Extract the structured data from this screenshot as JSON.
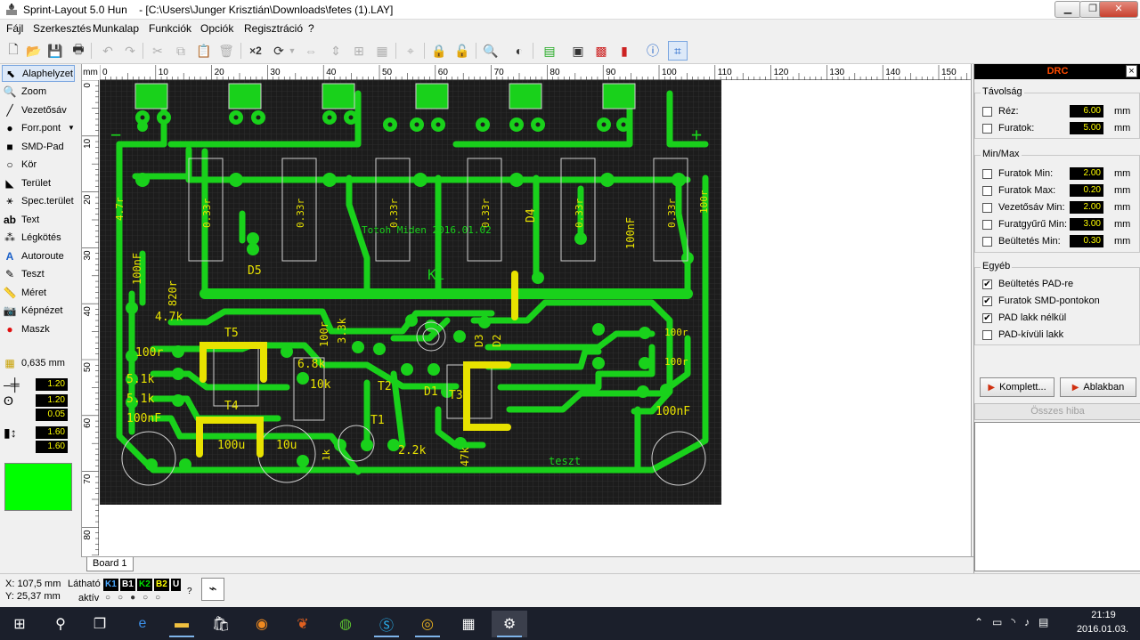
{
  "window": {
    "app_title": "Sprint-Layout 5.0 Hun",
    "file_path": "- [C:\\Users\\Junger Krisztián\\Downloads\\fetes (1).LAY]"
  },
  "menu": [
    "Fájl",
    "Szerkesztés",
    "Munkalap",
    "Funkciók",
    "Opciók",
    "Regisztráció",
    "?"
  ],
  "tools": [
    {
      "icon": "arrow-cursor-icon",
      "label": "Alaphelyzet",
      "active": true
    },
    {
      "icon": "magnifier-icon",
      "label": "Zoom"
    },
    {
      "icon": "track-icon",
      "label": "Vezetősáv"
    },
    {
      "icon": "pad-icon",
      "label": "Forr.pont",
      "dropdown": true
    },
    {
      "icon": "smd-pad-icon",
      "label": "SMD-Pad"
    },
    {
      "icon": "circle-icon",
      "label": "Kör"
    },
    {
      "icon": "zone-icon",
      "label": "Terület"
    },
    {
      "icon": "special-zone-icon",
      "label": "Spec.terület"
    },
    {
      "icon": "text-icon",
      "label": "Text"
    },
    {
      "icon": "airwire-icon",
      "label": "Légkötés"
    },
    {
      "icon": "autoroute-icon",
      "label": "Autoroute"
    },
    {
      "icon": "test-icon",
      "label": "Teszt"
    },
    {
      "icon": "measure-icon",
      "label": "Méret"
    },
    {
      "icon": "camera-icon",
      "label": "Képnézet"
    },
    {
      "icon": "mask-icon",
      "label": "Maszk"
    }
  ],
  "grid": {
    "value": "0,635 mm"
  },
  "track_values": [
    {
      "icon": "track-width-icon",
      "value": "1.20"
    },
    {
      "icon": "pad-size-icon",
      "outer": "1.20",
      "inner": "0.05"
    },
    {
      "icon": "smd-size-icon",
      "w": "1.60",
      "h": "1.60"
    }
  ],
  "active_color": "#00ff00",
  "ruler": {
    "unit": "mm",
    "h_ticks": [
      "0",
      "10",
      "20",
      "30",
      "40",
      "50",
      "60",
      "70",
      "80",
      "90",
      "100",
      "110",
      "120",
      "130",
      "140",
      "150"
    ],
    "v_ticks": [
      "0",
      "10",
      "20",
      "30",
      "40",
      "50",
      "60",
      "70",
      "80"
    ]
  },
  "board_tab": "Board 1",
  "pcb": {
    "silk_labels": [
      "0.33r",
      "0.33r",
      "0.33r",
      "0.33r",
      "0.33r",
      "0.33r",
      "D5",
      "D4",
      "Ki",
      "T5",
      "T4",
      "T3",
      "T2",
      "T1",
      "D1",
      "D2",
      "D3",
      "10k",
      "6.8k",
      "3.3k",
      "100r",
      "100r",
      "100r",
      "100r",
      "100nF",
      "100nF",
      "100nF",
      "100nF",
      "100u",
      "10u",
      "2.2k",
      "47k",
      "4.7k",
      "5.1k",
      "5.1k",
      "4.7r",
      "100r",
      "820r",
      "1k",
      "teszt",
      "Totoh Miden 2016.01.02"
    ]
  },
  "drc": {
    "title": "DRC",
    "close": "×",
    "tavolsag_title": "Távolság",
    "tavolsag": [
      {
        "label": "Réz:",
        "value": "6.00",
        "unit": "mm",
        "checked": false
      },
      {
        "label": "Furatok:",
        "value": "5.00",
        "unit": "mm",
        "checked": false
      }
    ],
    "minmax_title": "Min/Max",
    "minmax": [
      {
        "label": "Furatok Min:",
        "value": "2.00",
        "unit": "mm",
        "checked": false
      },
      {
        "label": "Furatok Max:",
        "value": "0.20",
        "unit": "mm",
        "checked": false
      },
      {
        "label": "Vezetősáv Min:",
        "value": "2.00",
        "unit": "mm",
        "checked": false
      },
      {
        "label": "Furatgyűrű Min:",
        "value": "3.00",
        "unit": "mm",
        "checked": false
      },
      {
        "label": "Beültetés Min:",
        "value": "0.30",
        "unit": "mm",
        "checked": false
      }
    ],
    "egyeb_title": "Egyéb",
    "egyeb": [
      {
        "label": "Beültetés PAD-re",
        "checked": true
      },
      {
        "label": "Furatok SMD-pontokon",
        "checked": true
      },
      {
        "label": "PAD lakk nélkül",
        "checked": true
      },
      {
        "label": "PAD-kívüli lakk",
        "checked": false
      }
    ],
    "btn_complete": "Komplett...",
    "btn_window": "Ablakban",
    "all_errors": "Összes hiba"
  },
  "status": {
    "x": "X:  107,5 mm",
    "y": "Y:  25,37 mm",
    "visible_label": "Látható",
    "active_label": "aktív",
    "layers": [
      {
        "name": "K1",
        "color": "#4aa8ff"
      },
      {
        "name": "B1",
        "color": "#ffffff"
      },
      {
        "name": "K2",
        "color": "#00e000"
      },
      {
        "name": "B2",
        "color": "#ffff00"
      },
      {
        "name": "U",
        "color": "#ffffff"
      }
    ],
    "help": "?"
  },
  "taskbar": {
    "time": "21:19",
    "date": "2016.01.03."
  }
}
